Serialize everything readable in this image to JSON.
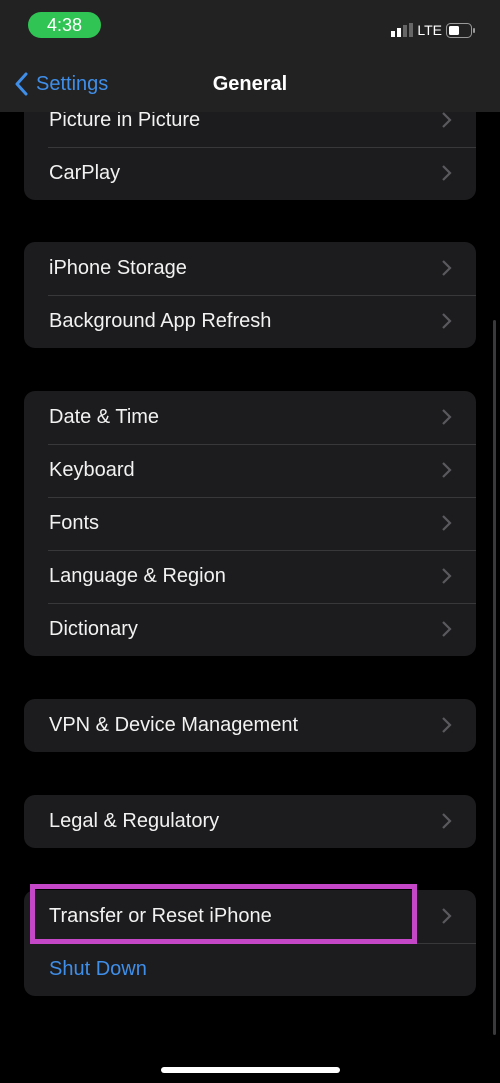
{
  "status_bar": {
    "time": "4:38",
    "network": "LTE",
    "time_pill_color": "#30c454"
  },
  "nav": {
    "back_label": "Settings",
    "title": "General",
    "accent": "#3f8ee8"
  },
  "groups": [
    [
      {
        "label": "Picture in Picture"
      },
      {
        "label": "CarPlay"
      }
    ],
    [
      {
        "label": "iPhone Storage"
      },
      {
        "label": "Background App Refresh"
      }
    ],
    [
      {
        "label": "Date & Time"
      },
      {
        "label": "Keyboard"
      },
      {
        "label": "Fonts"
      },
      {
        "label": "Language & Region"
      },
      {
        "label": "Dictionary"
      }
    ],
    [
      {
        "label": "VPN & Device Management"
      }
    ],
    [
      {
        "label": "Legal & Regulatory"
      }
    ],
    [
      {
        "label": "Transfer or Reset iPhone"
      },
      {
        "label": "Shut Down"
      }
    ]
  ],
  "highlight_color": "#c447c8"
}
